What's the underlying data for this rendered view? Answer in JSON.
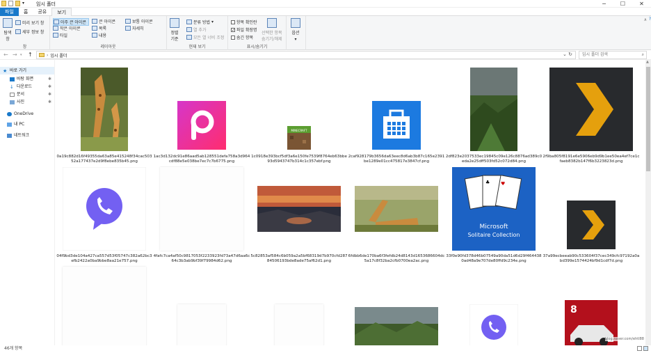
{
  "window": {
    "title": "임시 폴더",
    "controls": [
      "─",
      "☐",
      "✕"
    ]
  },
  "tabs": [
    {
      "label": "파일"
    },
    {
      "label": "홈"
    },
    {
      "label": "공유"
    },
    {
      "label": "보기"
    }
  ],
  "ribbon": {
    "pane": {
      "nav_pane": "탐색\n창",
      "preview": "미리 보기 창",
      "details": "세부 정보 창",
      "label": "창"
    },
    "layout": {
      "items": [
        "아주 큰 아이콘",
        "큰 아이콘",
        "보통 아이콘",
        "작은 아이콘",
        "목록",
        "자세히",
        "타일",
        "내용"
      ],
      "label": "레이아웃"
    },
    "current_view": {
      "sort": "정렬\n기준",
      "group_by": "분류 방법",
      "add_columns": "열 추가",
      "fit_columns": "모든 열 너비 조정",
      "label": "현재 보기"
    },
    "show_hide": {
      "checkboxes": "항목 확인란",
      "extensions": "파일 확장명",
      "hidden": "숨긴 항목",
      "hide_selected": "선택한 항목\n숨기기/해제",
      "label": "표시/숨기기"
    },
    "options": {
      "label": "옵션"
    }
  },
  "address": {
    "path": "임시 폴더",
    "search_placeholder": "임시 폴더 검색"
  },
  "nav": {
    "items": [
      {
        "label": "바로 가기",
        "selected": true
      },
      {
        "label": "바탕 화면",
        "pinned": true
      },
      {
        "label": "다운로드",
        "pinned": true
      },
      {
        "label": "문서",
        "pinned": true
      },
      {
        "label": "사진",
        "pinned": true
      },
      {
        "label": "OneDrive"
      },
      {
        "label": "내 PC"
      },
      {
        "label": "네트워크"
      }
    ]
  },
  "files": [
    {
      "name": "0a19c882d16f49355da63a85e415248f34cac50352a177437e2d9f8ebe835b45.png",
      "kind": "giraffe"
    },
    {
      "name": "1ac3d132dc91e86aad5ab128551defa758a3d964cdf88e5e038be7ec7c7b6775.png",
      "kind": "picsart"
    },
    {
      "name": "1c0918e393bcf5df3a6e150fe7539f8764eb63bbe93d5943747b314c1c357ebf.png",
      "kind": "minecraft"
    },
    {
      "name": "2caf928179b3656da63eec8d6ab3b87c165e2391be1289e01cc475817e3847cf.png",
      "kind": "winstore"
    },
    {
      "name": "2df823e2037533ec19845c09e126c8876ad389c0eda2e25dff503fd52c072d84.png",
      "kind": "landscape"
    },
    {
      "name": "2f9ba805f8191e6e5906eb9d9b1ee50ea4ef7ce1cfaeb8382b147f6b3223823d.png",
      "kind": "plex"
    },
    {
      "name": "04f9bd3de104a427ca557d53f05747c382a62bc3efb2422a0ba9bbe8aa21e757.png",
      "kind": "viber"
    },
    {
      "name": "4fafc7ca4af50c9817053f2233923fd73a47d6aa6c64c3b3ab9bf39f79984d62.png",
      "kind": "blank"
    },
    {
      "name": "5c82853af584c6b059a2a5bf68319d7b970cfd28784506193bde8ade75af62d1.png",
      "kind": "sunset"
    },
    {
      "name": "6fdbb6de170ba6f3fefdb24d8143d1653686604dc5a17c8f32ba2cfb0700ea2ac.png",
      "kind": "giraffe2"
    },
    {
      "name": "33f0e90fd378d46b07549a90da51d6d29f4644380ad48a9e707de80ffd9c234e.png",
      "kind": "solitaire"
    },
    {
      "name": "37a99ecbeeab90c533604f37cec349cfc97192a0abd399e1574424bf9d1cdf7d.png",
      "kind": "plex2"
    },
    {
      "name": "",
      "kind": "blank2"
    },
    {
      "name": "",
      "kind": "blank3"
    },
    {
      "name": "",
      "kind": "blank4"
    },
    {
      "name": "",
      "kind": "landscape2"
    },
    {
      "name": "",
      "kind": "viber2"
    },
    {
      "name": "",
      "kind": "asphalt"
    }
  ],
  "solitaire_text": {
    "brand": "Microsoft",
    "title": "Solitaire Collection"
  },
  "minecraft_text": "MINECRAFT",
  "asphalt_text": "8",
  "status": {
    "count": "46개 항목"
  },
  "watermark": {
    "text": "blog.naver.com/ehtl88"
  },
  "colors": {
    "accent": "#1979ca",
    "plex": "#e5a00d",
    "viber": "#7360f2",
    "winstore": "#1c7ae0"
  }
}
